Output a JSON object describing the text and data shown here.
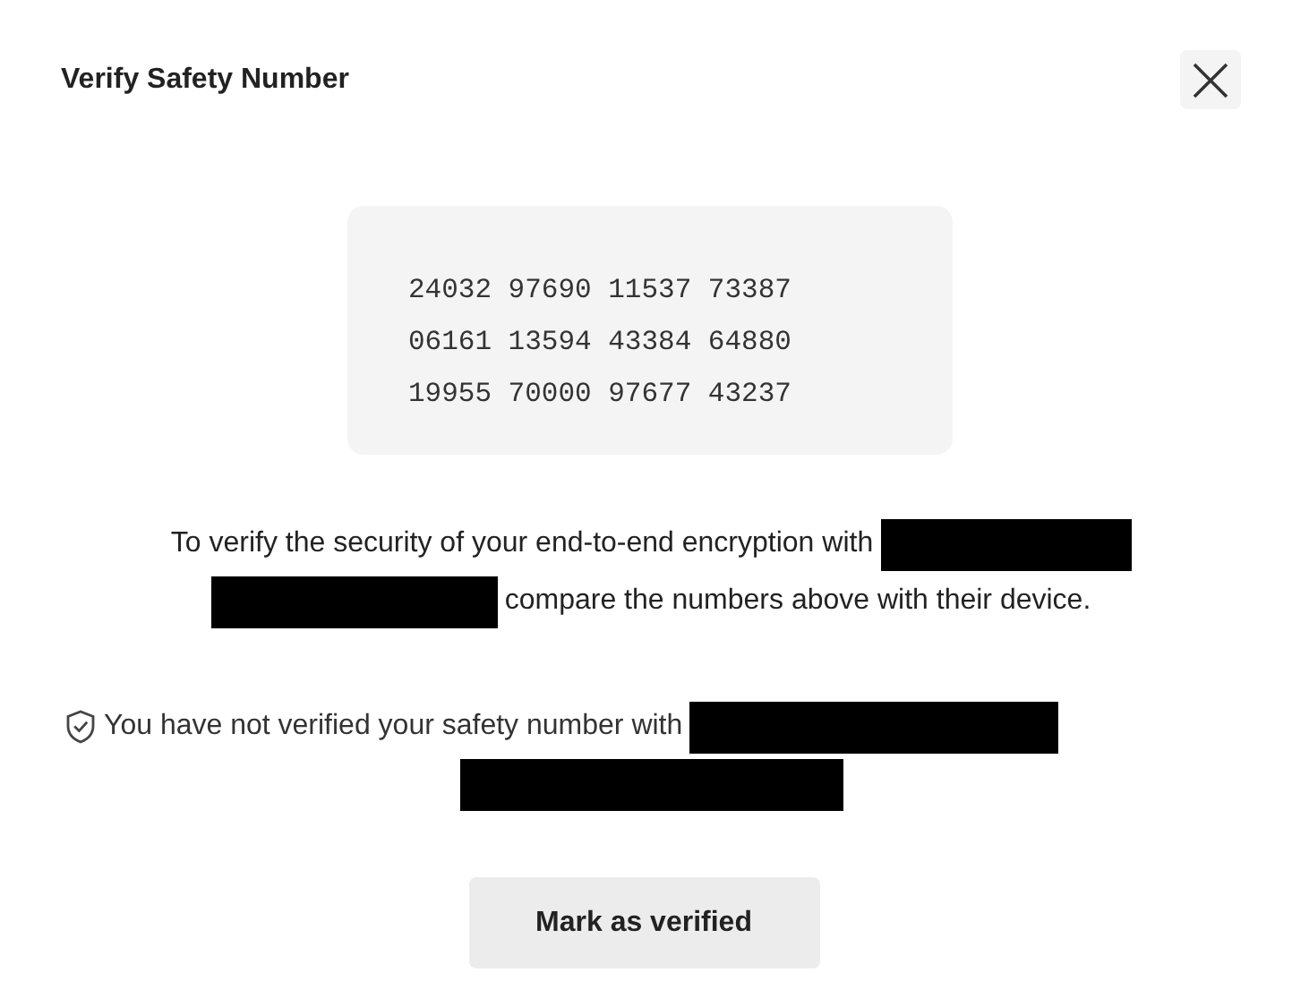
{
  "dialog": {
    "title": "Verify Safety Number"
  },
  "safety_number": {
    "rows": [
      "24032 97690 11537 73387",
      "06161 13594 43384 64880",
      "19955 70000 97677 43237"
    ]
  },
  "encryption_notice": {
    "before": "To verify the security of your end-to-end encryption with",
    "after": "compare the numbers above with their device."
  },
  "verification_status": {
    "verified": false,
    "text": "You have not verified your safety number with"
  },
  "buttons": [
    {
      "label": "Mark as verified"
    }
  ]
}
